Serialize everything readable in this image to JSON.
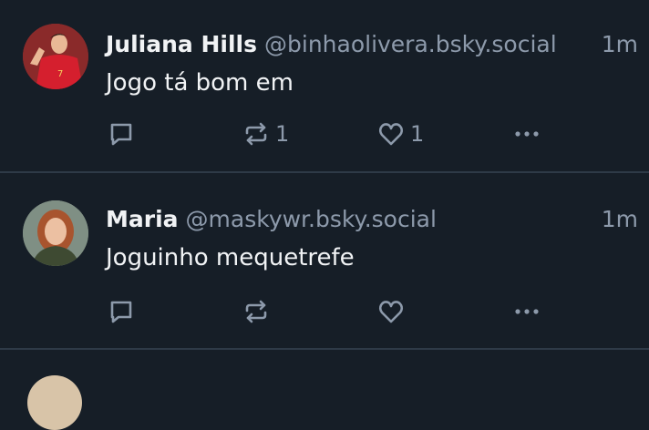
{
  "posts": [
    {
      "display_name": "Juliana Hills",
      "handle": "@binhaolivera.bsky.social",
      "time": "1m",
      "text": "Jogo tá bom em",
      "reply_icon": "speech-bubble-icon",
      "repost_icon": "repost-arrows-icon",
      "repost_count": "1",
      "like_icon": "heart-icon",
      "like_count": "1",
      "more_icon": "ellipsis-icon"
    },
    {
      "display_name": "Maria",
      "handle": "@maskywr.bsky.social",
      "time": "1m",
      "text": "Joguinho mequetrefe",
      "reply_icon": "speech-bubble-icon",
      "repost_icon": "repost-arrows-icon",
      "repost_count": "",
      "like_icon": "heart-icon",
      "like_count": "",
      "more_icon": "ellipsis-icon"
    }
  ],
  "colors": {
    "background": "#161e27",
    "text": "#f1f3f5",
    "muted": "#8d9aab",
    "divider": "#2e3a47"
  }
}
